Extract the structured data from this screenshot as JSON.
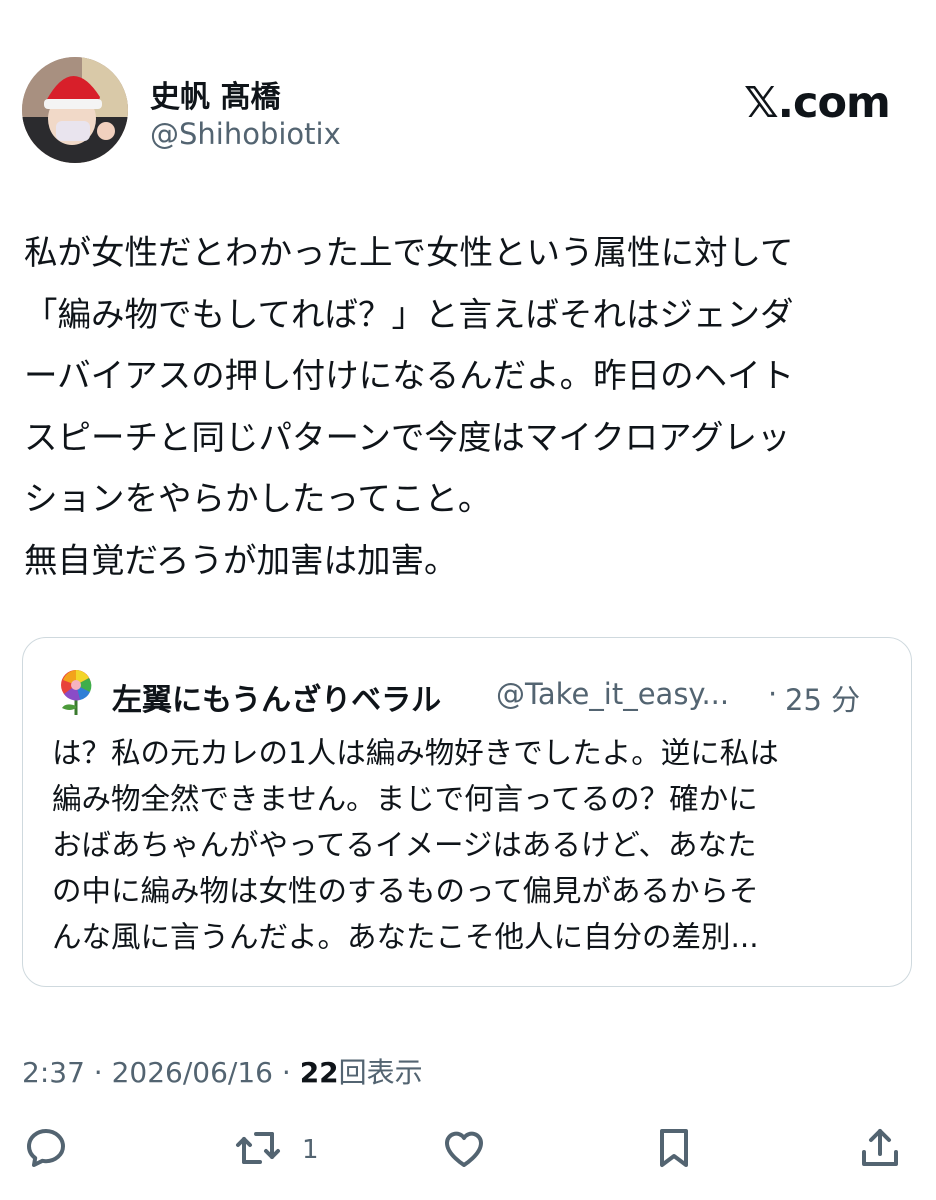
{
  "author": {
    "display_name": "史帆 髙橋",
    "handle": "@Shihobiotix",
    "avatar_icon": "profile-photo-avatar"
  },
  "site_logo": "𝕏.com",
  "post": {
    "text": "私が女性だとわかった上で女性という属性に対して\n「編み物でもしてれば？」と言えばそれはジェンダ\nーバイアスの押し付けになるんだよ。昨日のヘイト\nスピーチと同じパターンで今度はマイクロアグレッ\nションをやらかしたってこと。\n無自覚だろうが加害は加害。"
  },
  "quoted_post": {
    "display_name": "左翼にもうんざりベラル",
    "handle": "@Take_it_easy...",
    "separator": "·",
    "time": "25 分",
    "avatar_icon": "rainbow-rose-icon",
    "text": "は？私の元カレの1人は編み物好きでしたよ。逆に私は\n編み物全然できません。まじで何言ってるの？確かに\nおばあちゃんがやってるイメージはあるけど、あなた\nの中に編み物は女性のするものって偏見があるからそ\nんな風に言うんだよ。あなたこそ他人に自分の差別..."
  },
  "meta": {
    "time": "2:37",
    "sep1": " · ",
    "date": "2026/06/16",
    "sep2": " · ",
    "views_count": "22",
    "views_label": "回表示"
  },
  "actions": {
    "reply_icon": "reply-icon",
    "retweet_icon": "retweet-icon",
    "retweet_count": "1",
    "like_icon": "heart-icon",
    "bookmark_icon": "bookmark-icon",
    "share_icon": "share-icon"
  },
  "colors": {
    "text": "#0f1419",
    "secondary": "#536471",
    "border": "#cfd9de",
    "background": "#ffffff"
  }
}
